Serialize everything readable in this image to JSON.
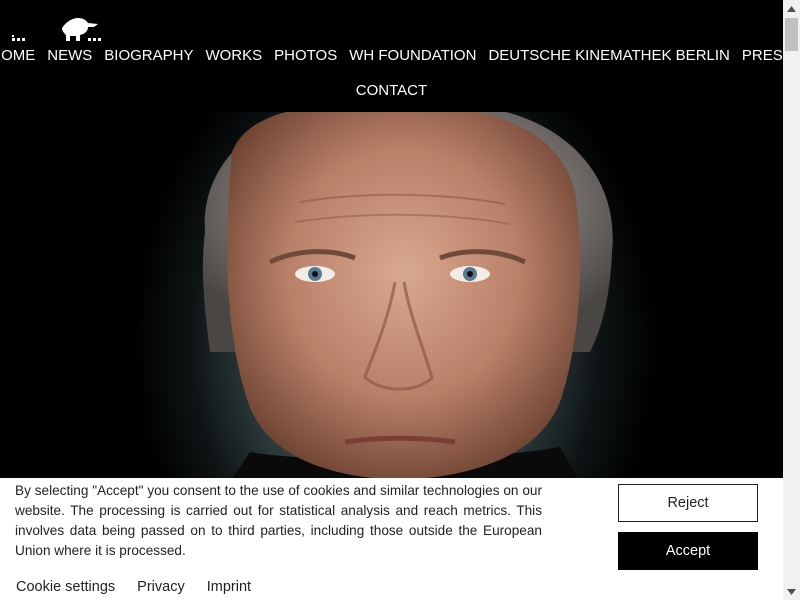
{
  "nav": {
    "items": [
      "HOME",
      "NEWS",
      "BIOGRAPHY",
      "WORKS",
      "PHOTOS",
      "WH FOUNDATION",
      "DEUTSCHE KINEMATHEK BERLIN",
      "PRESS"
    ],
    "contact": "CONTACT"
  },
  "hero": {
    "image": "portrait-photo"
  },
  "cookie_banner": {
    "text": "By selecting \"Accept\" you consent to the use of cookies and similar technologies on our website. The processing is carried out for statistical analysis and reach metrics. This involves data being passed on to third parties, including those outside the European Union where it is processed.",
    "reject_label": "Reject",
    "accept_label": "Accept",
    "links": [
      "Cookie settings",
      "Privacy",
      "Imprint"
    ]
  },
  "icons": {
    "logo": "logo-icon",
    "scroll_up": "chevron-up-icon",
    "scroll_down": "chevron-down-icon"
  },
  "colors": {
    "header_bg": "#000000",
    "nav_text": "#ffffff",
    "banner_bg": "#ffffff",
    "accept_bg": "#000000"
  }
}
